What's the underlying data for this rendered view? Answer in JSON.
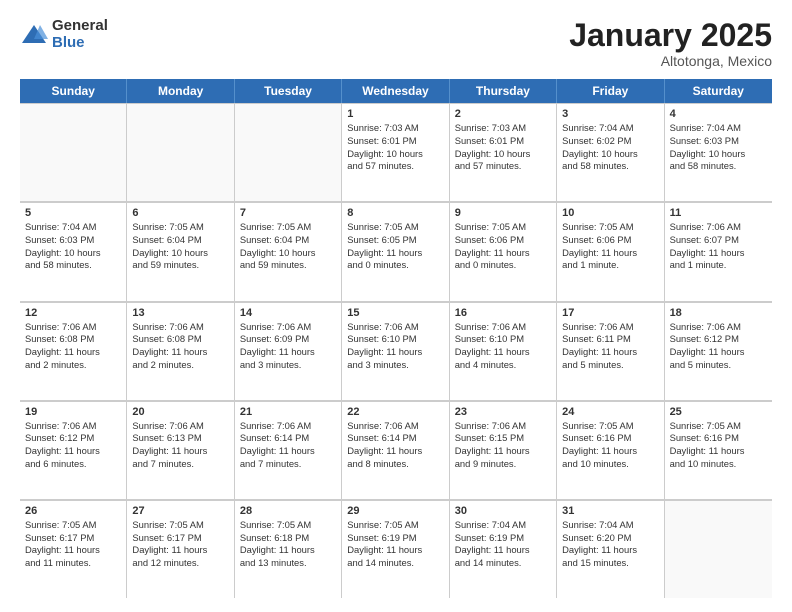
{
  "header": {
    "logo_general": "General",
    "logo_blue": "Blue",
    "month_title": "January 2025",
    "location": "Altotonga, Mexico"
  },
  "days_of_week": [
    "Sunday",
    "Monday",
    "Tuesday",
    "Wednesday",
    "Thursday",
    "Friday",
    "Saturday"
  ],
  "weeks": [
    [
      {
        "day": "",
        "info": ""
      },
      {
        "day": "",
        "info": ""
      },
      {
        "day": "",
        "info": ""
      },
      {
        "day": "1",
        "info": "Sunrise: 7:03 AM\nSunset: 6:01 PM\nDaylight: 10 hours\nand 57 minutes."
      },
      {
        "day": "2",
        "info": "Sunrise: 7:03 AM\nSunset: 6:01 PM\nDaylight: 10 hours\nand 57 minutes."
      },
      {
        "day": "3",
        "info": "Sunrise: 7:04 AM\nSunset: 6:02 PM\nDaylight: 10 hours\nand 58 minutes."
      },
      {
        "day": "4",
        "info": "Sunrise: 7:04 AM\nSunset: 6:03 PM\nDaylight: 10 hours\nand 58 minutes."
      }
    ],
    [
      {
        "day": "5",
        "info": "Sunrise: 7:04 AM\nSunset: 6:03 PM\nDaylight: 10 hours\nand 58 minutes."
      },
      {
        "day": "6",
        "info": "Sunrise: 7:05 AM\nSunset: 6:04 PM\nDaylight: 10 hours\nand 59 minutes."
      },
      {
        "day": "7",
        "info": "Sunrise: 7:05 AM\nSunset: 6:04 PM\nDaylight: 10 hours\nand 59 minutes."
      },
      {
        "day": "8",
        "info": "Sunrise: 7:05 AM\nSunset: 6:05 PM\nDaylight: 11 hours\nand 0 minutes."
      },
      {
        "day": "9",
        "info": "Sunrise: 7:05 AM\nSunset: 6:06 PM\nDaylight: 11 hours\nand 0 minutes."
      },
      {
        "day": "10",
        "info": "Sunrise: 7:05 AM\nSunset: 6:06 PM\nDaylight: 11 hours\nand 1 minute."
      },
      {
        "day": "11",
        "info": "Sunrise: 7:06 AM\nSunset: 6:07 PM\nDaylight: 11 hours\nand 1 minute."
      }
    ],
    [
      {
        "day": "12",
        "info": "Sunrise: 7:06 AM\nSunset: 6:08 PM\nDaylight: 11 hours\nand 2 minutes."
      },
      {
        "day": "13",
        "info": "Sunrise: 7:06 AM\nSunset: 6:08 PM\nDaylight: 11 hours\nand 2 minutes."
      },
      {
        "day": "14",
        "info": "Sunrise: 7:06 AM\nSunset: 6:09 PM\nDaylight: 11 hours\nand 3 minutes."
      },
      {
        "day": "15",
        "info": "Sunrise: 7:06 AM\nSunset: 6:10 PM\nDaylight: 11 hours\nand 3 minutes."
      },
      {
        "day": "16",
        "info": "Sunrise: 7:06 AM\nSunset: 6:10 PM\nDaylight: 11 hours\nand 4 minutes."
      },
      {
        "day": "17",
        "info": "Sunrise: 7:06 AM\nSunset: 6:11 PM\nDaylight: 11 hours\nand 5 minutes."
      },
      {
        "day": "18",
        "info": "Sunrise: 7:06 AM\nSunset: 6:12 PM\nDaylight: 11 hours\nand 5 minutes."
      }
    ],
    [
      {
        "day": "19",
        "info": "Sunrise: 7:06 AM\nSunset: 6:12 PM\nDaylight: 11 hours\nand 6 minutes."
      },
      {
        "day": "20",
        "info": "Sunrise: 7:06 AM\nSunset: 6:13 PM\nDaylight: 11 hours\nand 7 minutes."
      },
      {
        "day": "21",
        "info": "Sunrise: 7:06 AM\nSunset: 6:14 PM\nDaylight: 11 hours\nand 7 minutes."
      },
      {
        "day": "22",
        "info": "Sunrise: 7:06 AM\nSunset: 6:14 PM\nDaylight: 11 hours\nand 8 minutes."
      },
      {
        "day": "23",
        "info": "Sunrise: 7:06 AM\nSunset: 6:15 PM\nDaylight: 11 hours\nand 9 minutes."
      },
      {
        "day": "24",
        "info": "Sunrise: 7:05 AM\nSunset: 6:16 PM\nDaylight: 11 hours\nand 10 minutes."
      },
      {
        "day": "25",
        "info": "Sunrise: 7:05 AM\nSunset: 6:16 PM\nDaylight: 11 hours\nand 10 minutes."
      }
    ],
    [
      {
        "day": "26",
        "info": "Sunrise: 7:05 AM\nSunset: 6:17 PM\nDaylight: 11 hours\nand 11 minutes."
      },
      {
        "day": "27",
        "info": "Sunrise: 7:05 AM\nSunset: 6:17 PM\nDaylight: 11 hours\nand 12 minutes."
      },
      {
        "day": "28",
        "info": "Sunrise: 7:05 AM\nSunset: 6:18 PM\nDaylight: 11 hours\nand 13 minutes."
      },
      {
        "day": "29",
        "info": "Sunrise: 7:05 AM\nSunset: 6:19 PM\nDaylight: 11 hours\nand 14 minutes."
      },
      {
        "day": "30",
        "info": "Sunrise: 7:04 AM\nSunset: 6:19 PM\nDaylight: 11 hours\nand 14 minutes."
      },
      {
        "day": "31",
        "info": "Sunrise: 7:04 AM\nSunset: 6:20 PM\nDaylight: 11 hours\nand 15 minutes."
      },
      {
        "day": "",
        "info": ""
      }
    ]
  ]
}
